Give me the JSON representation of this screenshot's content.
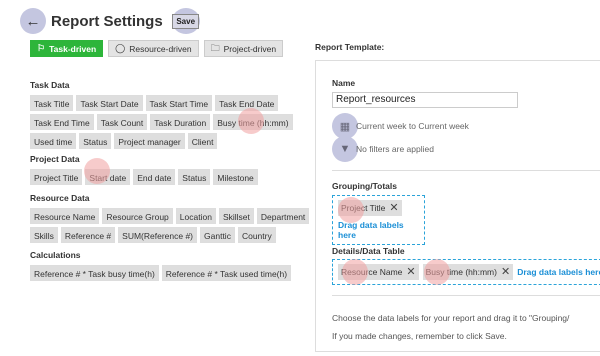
{
  "header": {
    "title": "Report Settings",
    "save_label": "Save"
  },
  "modes": [
    {
      "label": "Task-driven",
      "active": true
    },
    {
      "label": "Resource-driven",
      "active": false
    },
    {
      "label": "Project-driven",
      "active": false
    }
  ],
  "task_data": {
    "title": "Task Data",
    "rows": [
      [
        "Task Title",
        "Task Start Date",
        "Task Start Time",
        "Task End Date"
      ],
      [
        "Task End Time",
        "Task Count",
        "Task Duration",
        "Busy time (hh:mm)"
      ],
      [
        "Used time",
        "Status",
        "Project manager",
        "Client"
      ]
    ]
  },
  "project_data": {
    "title": "Project Data",
    "rows": [
      [
        "Project Title",
        "Start date",
        "End date",
        "Status",
        "Milestone"
      ]
    ]
  },
  "resource_data": {
    "title": "Resource Data",
    "rows": [
      [
        "Resource Name",
        "Resource Group",
        "Location",
        "Skillset",
        "Department"
      ],
      [
        "Skills",
        "Reference #",
        "SUM(Reference #)",
        "Ganttic",
        "Country"
      ]
    ]
  },
  "calculations": {
    "title": "Calculations",
    "rows": [
      [
        "Reference # * Task busy time(h)",
        "Reference # * Task used time(h)"
      ]
    ]
  },
  "template": {
    "label": "Report Template:",
    "name_label": "Name",
    "name_value": "Report_resources",
    "date_range": "Current week to Current week",
    "filters": "No filters are applied",
    "grouping_title": "Grouping/Totals",
    "grouping_items": [
      "Project Title"
    ],
    "grouping_hint": "Drag data labels here",
    "details_title": "Details/Data Table",
    "details_items": [
      "Resource Name",
      "Busy time (hh:mm)"
    ],
    "details_hint": "Drag data labels here",
    "info_line1": "Choose the data labels for your report and drag it to \"Grouping/",
    "info_line2": "If you made changes, remember to click Save."
  },
  "colors": {
    "active_mode": "#2db53a",
    "drop_zone": "#2aa3d9",
    "hint_text": "#1b8fd6",
    "chip_bg": "#dedede"
  }
}
